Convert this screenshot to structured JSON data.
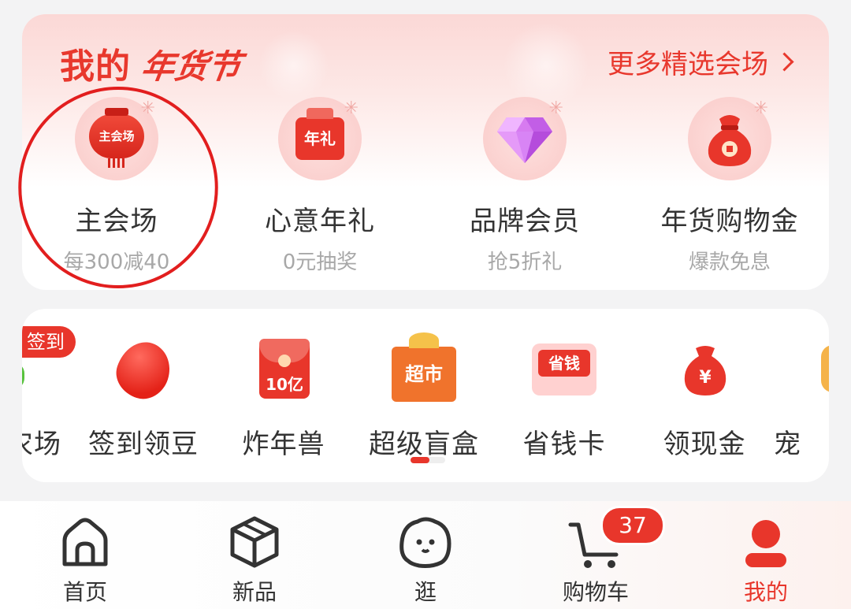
{
  "header": {
    "title_main": "我的",
    "title_script": "年货节",
    "more_link": "更多精选会场"
  },
  "venues": [
    {
      "name": "主会场",
      "sub": "每300减40",
      "icon_text": "主会场",
      "icon": "lantern-icon"
    },
    {
      "name": "心意年礼",
      "sub": "0元抽奖",
      "icon_text": "年礼",
      "icon": "gift-box-icon"
    },
    {
      "name": "品牌会员",
      "sub": "抢5折礼",
      "icon": "diamond-icon"
    },
    {
      "name": "年货购物金",
      "sub": "爆款免息",
      "icon": "money-bag-icon"
    }
  ],
  "features": {
    "badge": "签到",
    "items": [
      {
        "name": "农场",
        "icon": "farm-icon"
      },
      {
        "name": "签到领豆",
        "icon": "bean-icon"
      },
      {
        "name": "炸年兽",
        "icon": "red-envelope-icon",
        "icon_text": "10亿"
      },
      {
        "name": "超级盲盒",
        "icon": "supermarket-gift-icon",
        "icon_text": "超市"
      },
      {
        "name": "省钱卡",
        "icon": "savings-card-icon",
        "icon_text": "省钱"
      },
      {
        "name": "领现金",
        "icon": "cash-bag-icon",
        "icon_text": "¥"
      },
      {
        "name": "宠",
        "icon": "pet-icon"
      }
    ],
    "pager": {
      "pages": 2,
      "current": 1
    }
  },
  "tabbar": {
    "tabs": [
      {
        "label": "首页",
        "icon": "home-icon"
      },
      {
        "label": "新品",
        "icon": "cube-icon"
      },
      {
        "label": "逛",
        "icon": "browse-face-icon"
      },
      {
        "label": "购物车",
        "icon": "cart-icon",
        "badge": "37"
      },
      {
        "label": "我的",
        "icon": "profile-icon",
        "active": true
      }
    ]
  },
  "colors": {
    "accent": "#e8362b",
    "highlight_ring": "#e21e1e",
    "muted_text": "#a8a8a8"
  }
}
